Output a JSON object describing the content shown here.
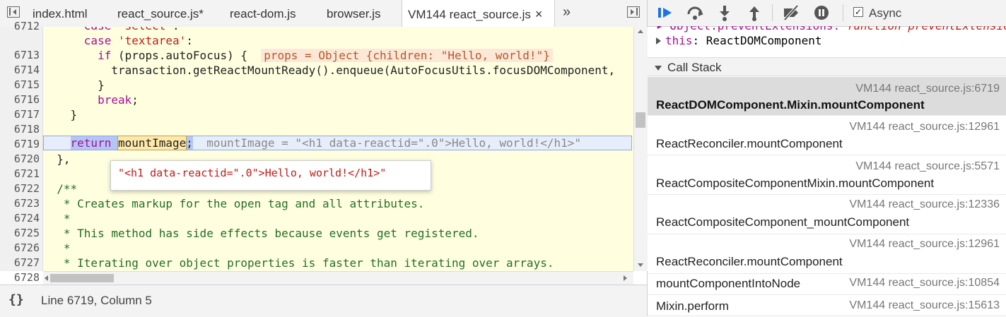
{
  "tabs": {
    "items": [
      "index.html",
      "react_source.js*",
      "react-dom.js",
      "browser.js"
    ],
    "active": "VM144 react_source.js",
    "close": "×",
    "more": "»"
  },
  "code": {
    "line_numbers": [
      "6712",
      "6713",
      "6714",
      "6715",
      "6716",
      "6717",
      "6718",
      "6719",
      "6720",
      "6721",
      "6722",
      "6723",
      "6724",
      "6725",
      "6726",
      "6727",
      "6728"
    ],
    "l6712_indent": "      ",
    "l6712_kw": "case",
    "l6712_str": "'select'",
    "l6712_end": ":",
    "l6712b_indent": "      ",
    "l6712b_kw": "case",
    "l6712b_str": "'textarea'",
    "l6712b_end": ":",
    "l6713_indent": "        ",
    "l6713_kw": "if",
    "l6713_text": " (props.autoFocus) {  ",
    "l6713_inline": "props = Object {children: \"Hello, world!\"}",
    "l6714_text": "          transaction.getReactMountReady().enqueue(AutoFocusUtils.focusDOMComponent, ",
    "l6715_text": "        }",
    "l6716_indent": "        ",
    "l6716_kw": "break",
    "l6716_end": ";",
    "l6717_text": "    }",
    "l6719_indent": "    ",
    "l6719_kw": "return",
    "l6719_sp": " ",
    "l6719_mount": "mountImage",
    "l6719_semi": ";",
    "l6719_inline": "  mountImage = \"<h1 data-reactid=\".0\">Hello, world!</h1>\"",
    "l6720_text": "  },",
    "l6722_text": "  /**",
    "l6723_text": "   * Creates markup for the open tag and all attributes.",
    "l6724_text": "   *",
    "l6725_text": "   * This method has side effects because events get registered.",
    "l6726_text": "   *",
    "l6727_text": "   * Iterating over object properties is faster than iterating over arrays."
  },
  "tooltip": "\"<h1 data-reactid=\".0\">Hello, world!</h1>\"",
  "status": {
    "braces": "{}",
    "position": "Line 6719, Column 5"
  },
  "debugger": {
    "async_label": "Async",
    "async_checked": "✓",
    "scope_line1_prop": "▸ Object.preventExtensions: ",
    "scope_line1_val": "function preventExtensions()",
    "scope_this_name": "this",
    "scope_this_val": ": ReactDOMComponent",
    "call_stack_label": "Call Stack",
    "frames": [
      {
        "name": "ReactDOMComponent.Mixin.mountComponent",
        "loc": "VM144 react_source.js:6719"
      },
      {
        "name": "ReactReconciler.mountComponent",
        "loc": "VM144 react_source.js:12961"
      },
      {
        "name": "ReactCompositeComponentMixin.mountComponent",
        "loc": "VM144 react_source.js:5571"
      },
      {
        "name": "ReactCompositeComponent_mountComponent",
        "loc": "VM144 react_source.js:12336"
      },
      {
        "name": "ReactReconciler.mountComponent",
        "loc": "VM144 react_source.js:12961"
      },
      {
        "name": "mountComponentIntoNode",
        "loc": "VM144 react_source.js:10854"
      },
      {
        "name": "Mixin.perform",
        "loc": "VM144 react_source.js:15613"
      }
    ]
  }
}
